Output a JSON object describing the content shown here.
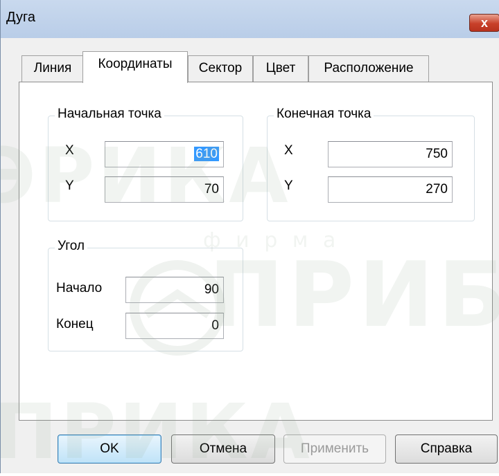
{
  "window": {
    "title": "Дуга",
    "close_label": "x"
  },
  "tabs": [
    {
      "label": "Линия",
      "active": false
    },
    {
      "label": "Координаты",
      "active": true
    },
    {
      "label": "Сектор",
      "active": false
    },
    {
      "label": "Цвет",
      "active": false
    },
    {
      "label": "Расположение",
      "active": false
    }
  ],
  "start_point": {
    "title": "Начальная точка",
    "x_label": "X",
    "x_value": "610",
    "y_label": "Y",
    "y_value": "70"
  },
  "end_point": {
    "title": "Конечная точка",
    "x_label": "X",
    "x_value": "750",
    "y_label": "Y",
    "y_value": "270"
  },
  "angle": {
    "title": "Угол",
    "start_label": "Начало",
    "start_value": "90",
    "end_label": "Конец",
    "end_value": "0"
  },
  "buttons": {
    "ok": "OK",
    "cancel": "Отмена",
    "apply": "Применить",
    "help": "Справка"
  },
  "watermark": {
    "brand": "ПРИБОР",
    "word": "ф и р м а",
    "fragment_top": "ЭРИКА",
    "fragment_bottom": "ПРИКА"
  }
}
